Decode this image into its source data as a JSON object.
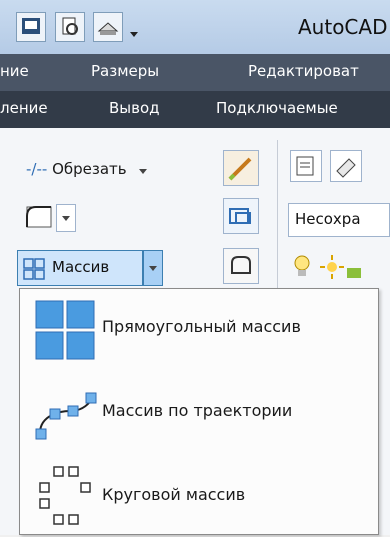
{
  "window": {
    "title": "AutoCAD"
  },
  "menubar": {
    "items": [
      "ние",
      "Размеры",
      "Редактироват"
    ]
  },
  "tabs": {
    "items": [
      "ление",
      "Вывод",
      "Подключаемые"
    ]
  },
  "ribbon": {
    "trim_label": "Обрезать",
    "array_label": "Массив",
    "layer_field": "Несохра"
  },
  "dropdown": {
    "items": [
      {
        "label": "Прямоугольный массив",
        "icon": "rectangular-array-icon"
      },
      {
        "label": "Массив по траектории",
        "icon": "path-array-icon"
      },
      {
        "label": "Круговой массив",
        "icon": "polar-array-icon"
      }
    ]
  },
  "colors": {
    "accent": "#3c7fb1",
    "menubar": "#4a5566",
    "tabbar": "#323b48",
    "icon_blue": "#5aa0e0"
  }
}
